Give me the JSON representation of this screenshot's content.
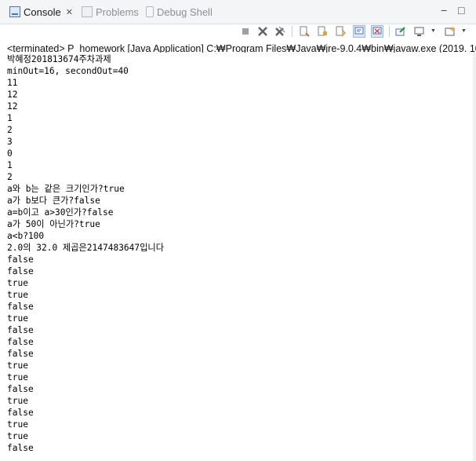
{
  "tabs": [
    {
      "label": "Console",
      "active": true,
      "icon": "console-icon"
    },
    {
      "label": "Problems",
      "active": false,
      "icon": "problems-icon"
    },
    {
      "label": "Debug Shell",
      "active": false,
      "icon": "debug-shell-icon"
    }
  ],
  "window_controls": {
    "minimize": "−",
    "maximize": "□"
  },
  "toolbar": {
    "icons": [
      "terminate-icon",
      "remove-launch-icon",
      "remove-all-terminated-icon",
      "clear-console-icon",
      "scroll-lock-icon",
      "word-wrap-icon",
      "show-on-stdout-icon",
      "show-on-stderr-icon",
      "pin-console-icon",
      "display-selected-console-icon",
      "open-console-icon"
    ]
  },
  "status_line": "<terminated> P_homework [Java Application] C:₩Program Files₩Java₩jre-9.0.4₩bin₩javaw.exe (2019. 10. 9. 오",
  "console_output": [
    "박혜정201813674주차과제",
    "minOut=16, secondOut=40",
    "11",
    "12",
    "12",
    "1",
    "2",
    "3",
    "0",
    "1",
    "2",
    "a와 b는 같은 크기인가?true",
    "a가 b보다 큰가?false",
    "a=b이고 a>30인가?false",
    "a가 50이 아닌가?true",
    "a<b?100",
    "2.0의 32.0 제곱은2147483647입니다",
    "false",
    "false",
    "true",
    "true",
    "false",
    "true",
    "false",
    "false",
    "false",
    "true",
    "true",
    "false",
    "true",
    "false",
    "true",
    "true",
    "false"
  ]
}
